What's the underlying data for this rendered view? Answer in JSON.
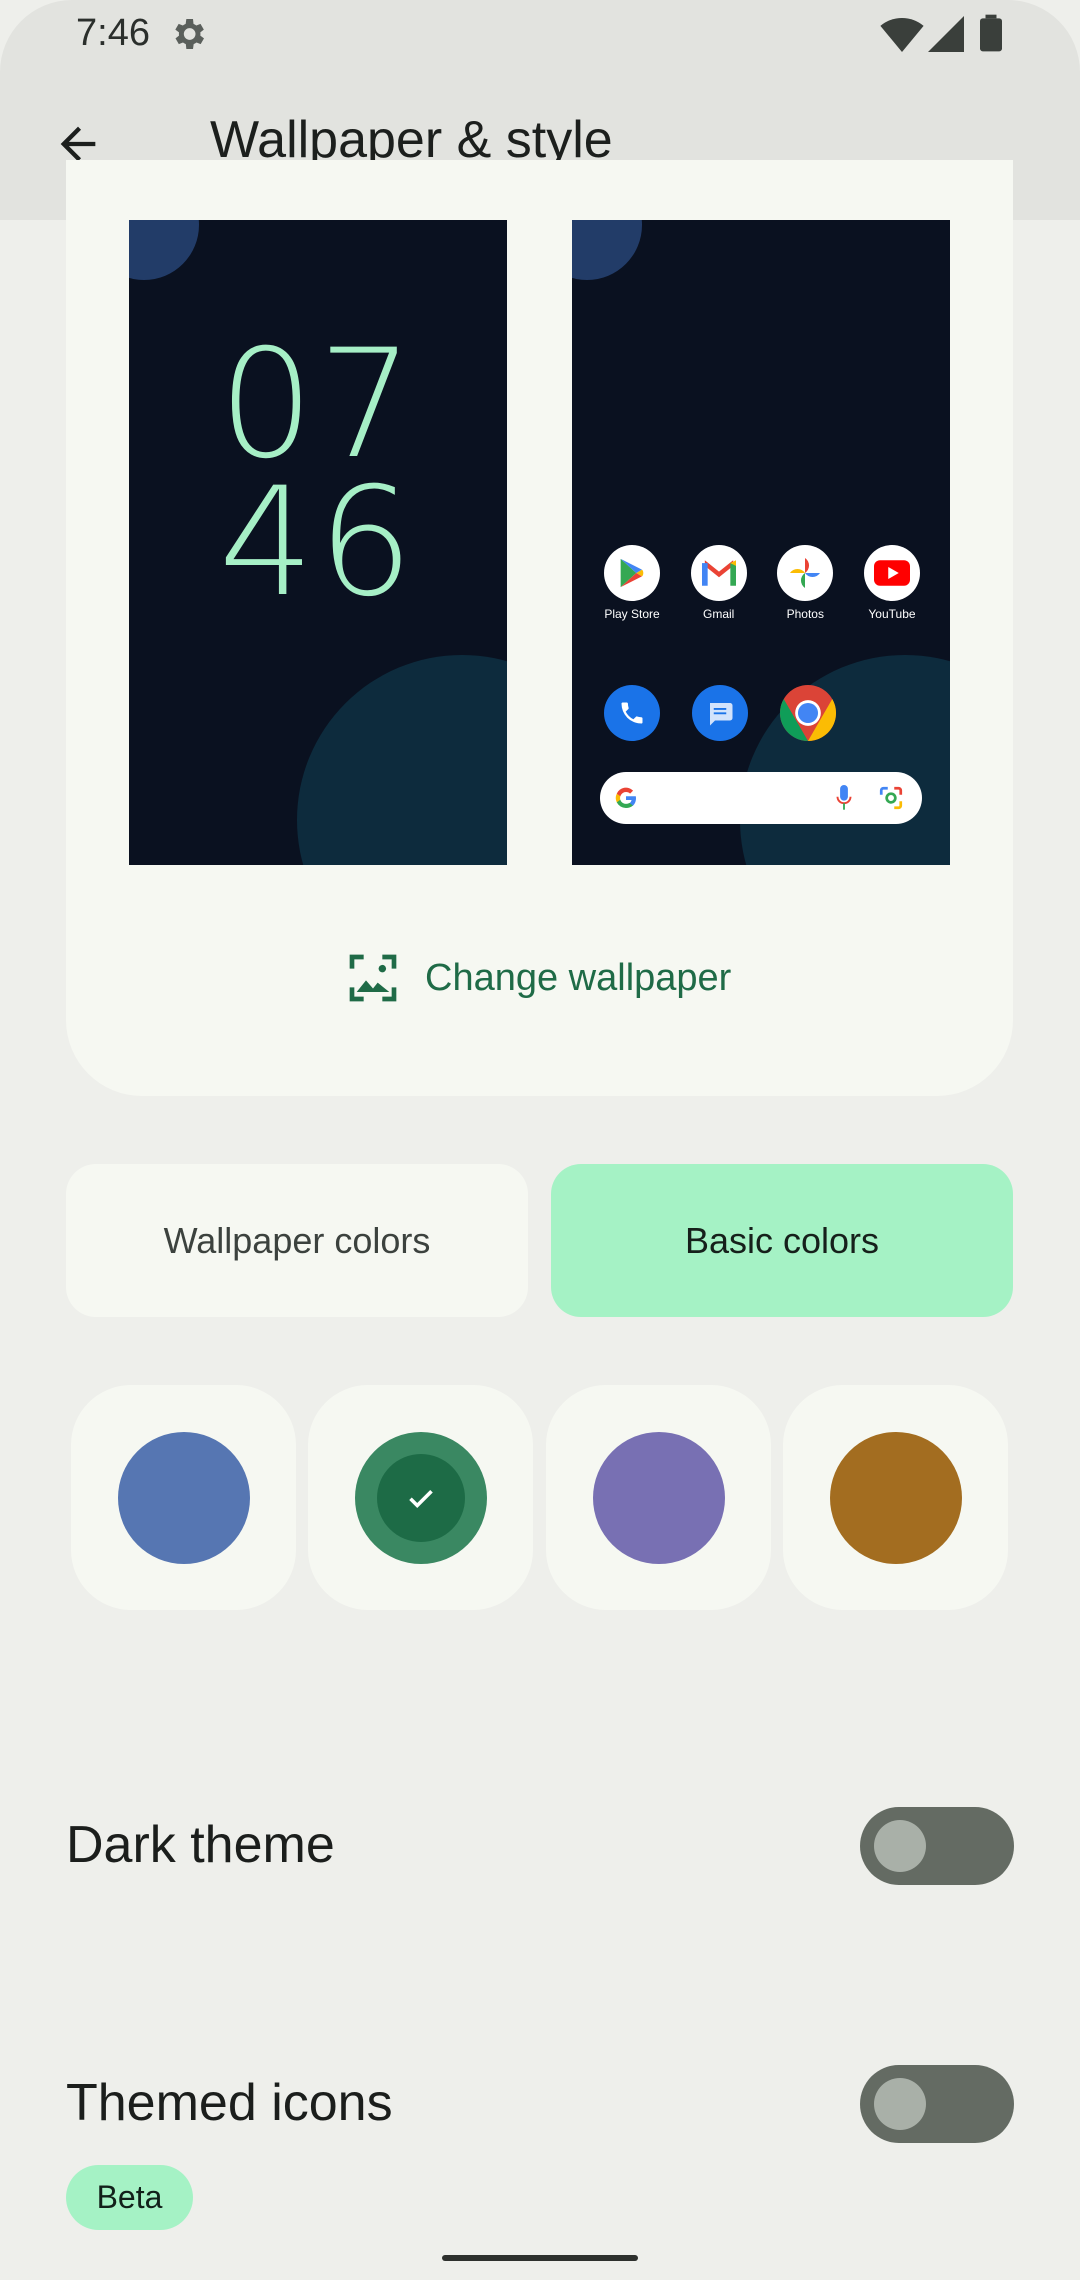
{
  "status": {
    "time": "7:46"
  },
  "app_bar": {
    "title": "Wallpaper & style"
  },
  "preview": {
    "lock_hour": "07",
    "lock_minute": "46",
    "apps_row1": [
      "Play Store",
      "Gmail",
      "Photos",
      "YouTube"
    ],
    "change_wallpaper": "Change wallpaper"
  },
  "tabs": {
    "wallpaper_colors": "Wallpaper colors",
    "basic_colors": "Basic colors",
    "selected": "Basic colors"
  },
  "swatches": [
    {
      "color": "#5676b2",
      "selected": false
    },
    {
      "color": "#3a8862",
      "selected": true
    },
    {
      "color": "#7870b3",
      "selected": false
    },
    {
      "color": "#a36d20",
      "selected": false
    }
  ],
  "settings": {
    "dark_theme": "Dark theme",
    "dark_theme_on": false,
    "themed_icons": "Themed icons",
    "themed_icons_on": false,
    "beta": "Beta"
  }
}
